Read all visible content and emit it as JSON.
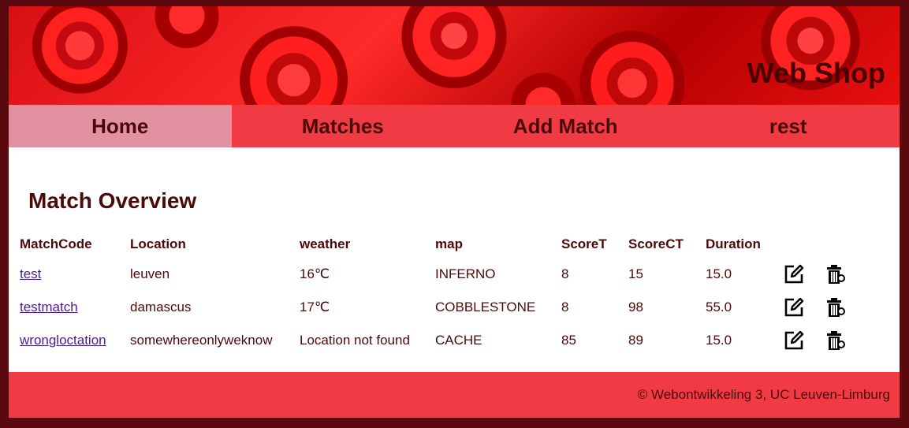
{
  "header": {
    "title": "Web Shop"
  },
  "nav": [
    {
      "label": "Home",
      "active": true
    },
    {
      "label": "Matches",
      "active": false
    },
    {
      "label": "Add Match",
      "active": false
    },
    {
      "label": "rest",
      "active": false
    }
  ],
  "main": {
    "title": "Match Overview",
    "columns": [
      "MatchCode",
      "Location",
      "weather",
      "map",
      "ScoreT",
      "ScoreCT",
      "Duration"
    ],
    "rows": [
      {
        "code": "test",
        "location": "leuven",
        "weather": "16℃",
        "map": "INFERNO",
        "scoreT": "8",
        "scoreCT": "15",
        "duration": "15.0"
      },
      {
        "code": "testmatch",
        "location": "damascus",
        "weather": "17℃",
        "map": "COBBLESTONE",
        "scoreT": "8",
        "scoreCT": "98",
        "duration": "55.0"
      },
      {
        "code": "wrongloctation",
        "location": "somewhereonlyweknow",
        "weather": "Location not found",
        "map": "CACHE",
        "scoreT": "85",
        "scoreCT": "89",
        "duration": "15.0"
      }
    ],
    "row_icons": {
      "edit": "edit-icon",
      "delete": "trash-icon"
    }
  },
  "footer": {
    "text": "© Webontwikkeling 3, UC Leuven-Limburg"
  },
  "colors": {
    "frame": "#5a0a0e",
    "nav": "#f03a44",
    "nav_active": "#e191a0",
    "text": "#4a0a0a",
    "link": "#4b1b8f"
  }
}
